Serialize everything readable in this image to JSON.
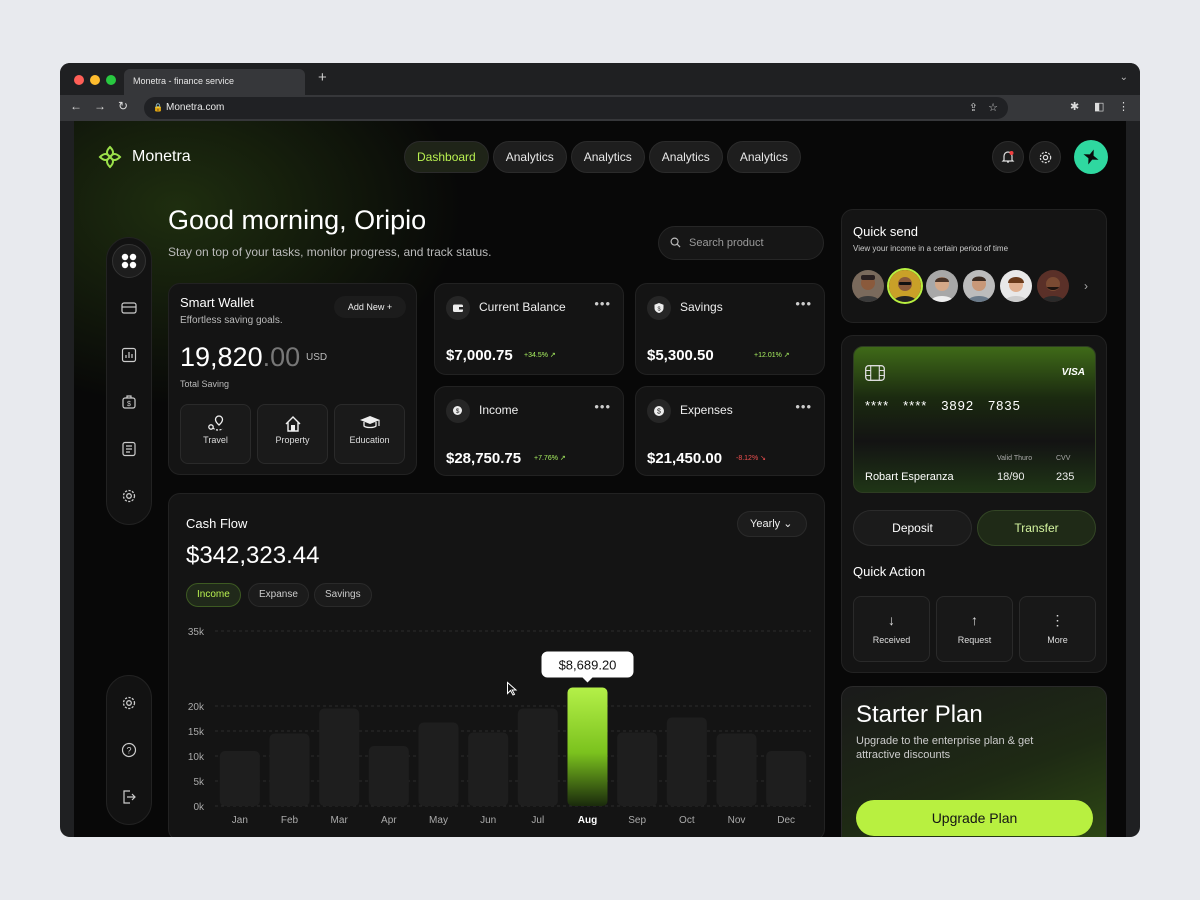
{
  "browser": {
    "tab_title": "Monetra - finance service",
    "url": "Monetra.com"
  },
  "app": {
    "brand": "Monetra",
    "nav": [
      "Dashboard",
      "Analytics",
      "Analytics",
      "Analytics",
      "Analytics"
    ],
    "active_nav": "Dashboard"
  },
  "header": {
    "greeting": "Good morning, Oripio",
    "subtitle": "Stay on top of your tasks, monitor progress, and track status.",
    "search_placeholder": "Search product"
  },
  "wallet": {
    "title": "Smart Wallet",
    "subtitle": "Effortless saving goals.",
    "add_new": "Add New",
    "amount_int": "19,820",
    "amount_dec": ".00",
    "currency": "USD",
    "total_label": "Total Saving",
    "categories": [
      "Travel",
      "Property",
      "Education"
    ]
  },
  "stats": [
    {
      "title": "Current Balance",
      "value": "$7,000.75",
      "change": "+34.5%",
      "trend": "up"
    },
    {
      "title": "Savings",
      "value": "$5,300.50",
      "change": "+12.01%",
      "trend": "up"
    },
    {
      "title": "Income",
      "value": "$28,750.75",
      "change": "+7.76%",
      "trend": "up"
    },
    {
      "title": "Expenses",
      "value": "$21,450.00",
      "change": "-8.12%",
      "trend": "down"
    }
  ],
  "cashflow": {
    "title": "Cash Flow",
    "value": "$342,323.44",
    "period": "Yearly",
    "tabs": [
      "Income",
      "Expanse",
      "Savings"
    ],
    "active_tab": "Income",
    "tooltip": "$8,689.20"
  },
  "chart_data": {
    "type": "bar",
    "categories": [
      "Jan",
      "Feb",
      "Mar",
      "Apr",
      "May",
      "Jun",
      "Jul",
      "Aug",
      "Sep",
      "Oct",
      "Nov",
      "Dec"
    ],
    "values": [
      11000,
      14500,
      19500,
      12000,
      16700,
      14700,
      19500,
      23700,
      14700,
      17700,
      14500,
      11000
    ],
    "ylim": [
      0,
      35000
    ],
    "yticks": [
      "0k",
      "5k",
      "10k",
      "15k",
      "20k",
      "35k"
    ],
    "ytick_values": [
      0,
      5000,
      10000,
      15000,
      20000,
      35000
    ],
    "highlight": "Aug",
    "highlight_color": "#a8f040",
    "bar_color": "#1e1e1e"
  },
  "quick_send": {
    "title": "Quick send",
    "subtitle": "View your income in a certain period of time",
    "contacts": 6
  },
  "card": {
    "brand": "VISA",
    "number": [
      "****",
      "****",
      "3892",
      "7835"
    ],
    "holder": "Robart Esperanza",
    "valid_label": "Valid Thuro",
    "valid": "18/90",
    "cvv_label": "CVV",
    "cvv": "235"
  },
  "actions": {
    "deposit": "Deposit",
    "transfer": "Transfer",
    "quick_action_title": "Quick Action",
    "items": [
      "Received",
      "Request",
      "More"
    ]
  },
  "plan": {
    "title": "Starter Plan",
    "subtitle": "Upgrade to the enterprise plan & get attractive discounts",
    "button": "Upgrade Plan"
  },
  "colors": {
    "accent": "#b8f040",
    "background": "#080808",
    "card": "#141414"
  }
}
